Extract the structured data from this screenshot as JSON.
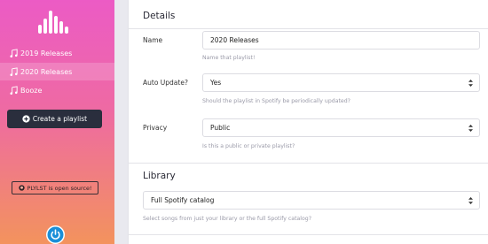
{
  "sidebar": {
    "items": [
      {
        "label": "2019 Releases"
      },
      {
        "label": "2020 Releases"
      },
      {
        "label": "Booze"
      }
    ],
    "create_label": "Create a playlist",
    "opensource_label": "PLYLST is open source!"
  },
  "details": {
    "title": "Details",
    "name_label": "Name",
    "name_value": "2020 Releases",
    "name_help": "Name that playlist!",
    "auto_label": "Auto Update?",
    "auto_value": "Yes",
    "auto_help": "Should the playlist in Spotify be periodically updated?",
    "privacy_label": "Privacy",
    "privacy_value": "Public",
    "privacy_help": "Is this a public or private playlist?"
  },
  "library": {
    "title": "Library",
    "value": "Full Spotify catalog",
    "help": "Select songs from just your library or the full Spotify catalog?"
  },
  "colors": {
    "sidebar_top": "#ec5bc5",
    "sidebar_bottom": "#f3935d",
    "button_dark": "#2a2e3d"
  },
  "icons": [
    "logo-bars-icon",
    "music-note-icon",
    "plus-circle-icon",
    "github-icon",
    "select-caret-icon",
    "power-icon"
  ]
}
